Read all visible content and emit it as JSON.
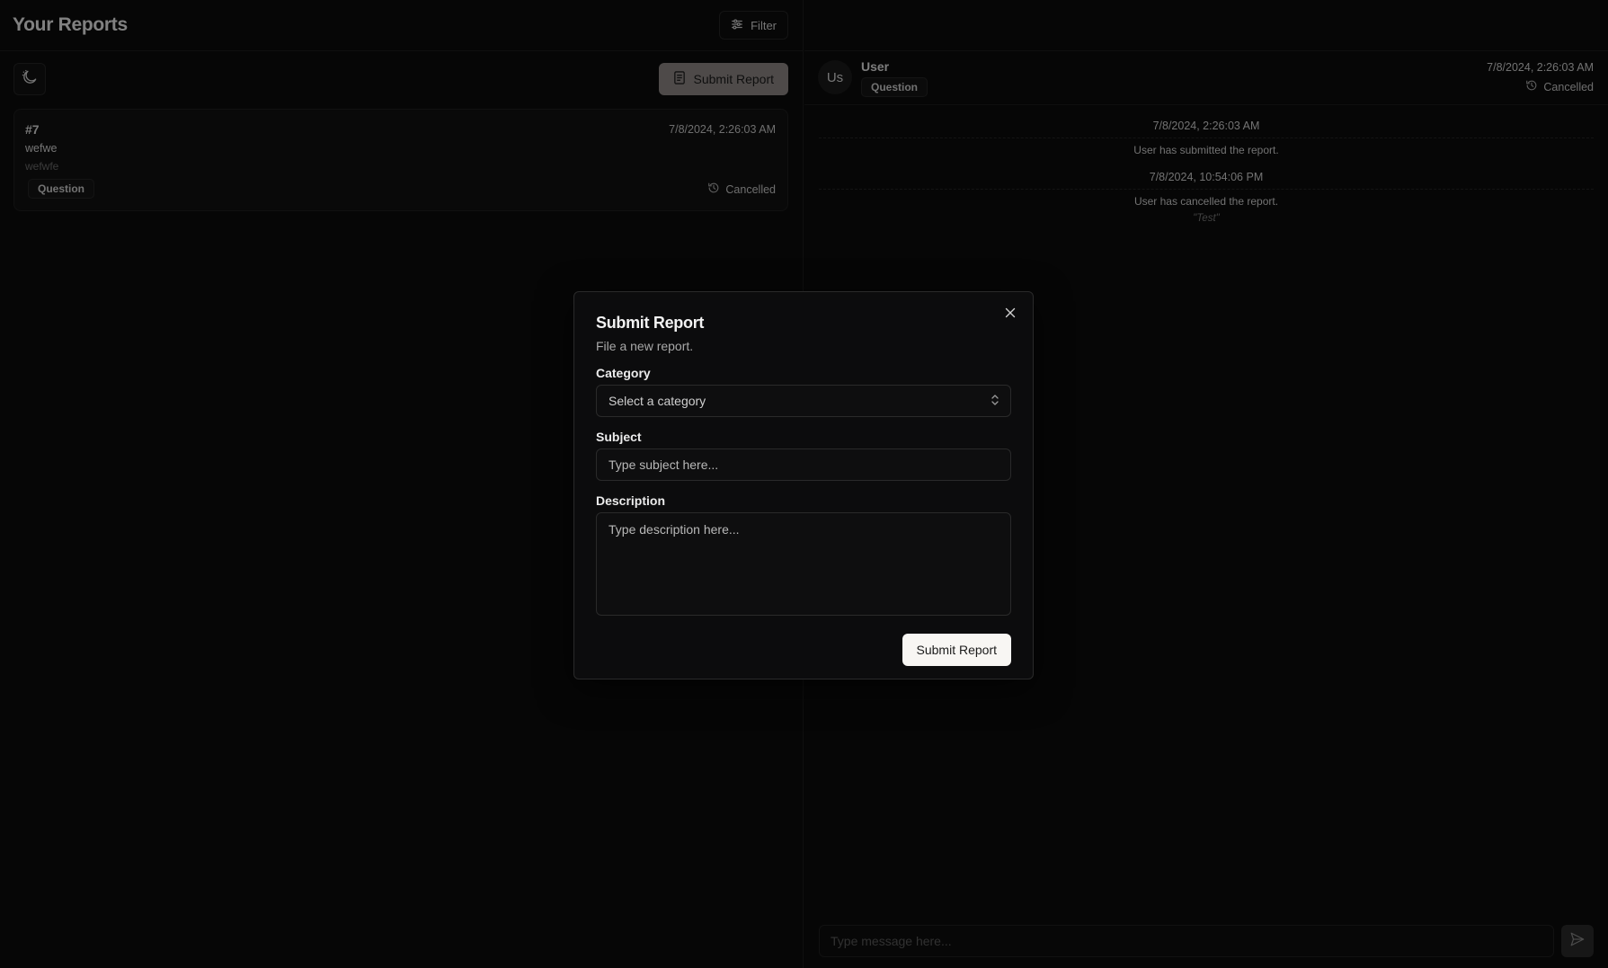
{
  "header": {
    "title": "Your Reports",
    "filter_label": "Filter"
  },
  "toolbar": {
    "submit_label": "Submit Report"
  },
  "reports": [
    {
      "id": "#7",
      "date": "7/8/2024, 2:26:03 AM",
      "subject": "wefwe",
      "description": "wefwfe",
      "category": "Question",
      "status": "Cancelled"
    }
  ],
  "chat": {
    "avatar_initials": "Us",
    "user_name": "User",
    "category": "Question",
    "date": "7/8/2024, 2:26:03 AM",
    "status": "Cancelled",
    "events": [
      {
        "date": "7/8/2024, 2:26:03 AM",
        "text": "User has submitted the report.",
        "note": ""
      },
      {
        "date": "7/8/2024, 10:54:06 PM",
        "text": "User has cancelled the report.",
        "note": "\"Test\""
      }
    ],
    "composer_placeholder": "Type message here..."
  },
  "modal": {
    "title": "Submit Report",
    "subtitle": "File a new report.",
    "category_label": "Category",
    "category_placeholder": "Select a category",
    "subject_label": "Subject",
    "subject_placeholder": "Type subject here...",
    "description_label": "Description",
    "description_placeholder": "Type description here...",
    "submit_label": "Submit Report"
  },
  "colors": {
    "background": "#0b0b0b",
    "primary_button_muted": "#8e8886",
    "modal_submit": "#f8f6f3"
  }
}
